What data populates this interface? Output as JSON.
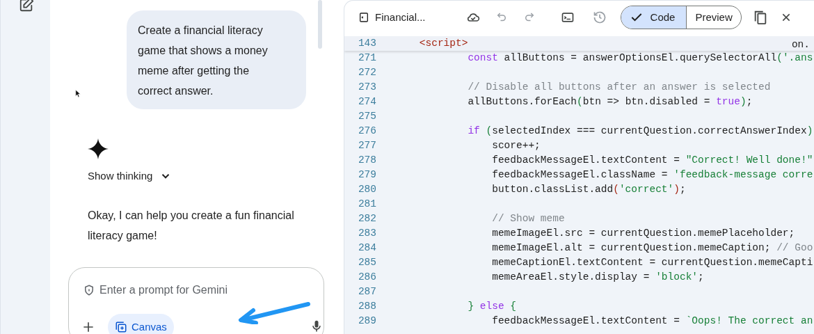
{
  "chat": {
    "user_message": "Create a financial literacy game that shows a money meme after getting the correct answer.",
    "thinking_toggle": {
      "label": "Show thinking",
      "expanded": false
    },
    "reply": "Okay, I can help you create a fun financial literacy game!",
    "prompt": {
      "placeholder": "Enter a prompt for Gemini",
      "tools": [
        {
          "label": "Canvas",
          "selected": true
        }
      ]
    }
  },
  "editor": {
    "file_title": "Financial...",
    "view_toggle": [
      {
        "label": "Code",
        "selected": true
      },
      {
        "label": "Preview",
        "selected": false
      }
    ],
    "sticky_line": {
      "number": "143",
      "kind": "script",
      "tokens": [
        {
          "kind": "tag",
          "text": "<script>"
        }
      ],
      "tail": "on."
    },
    "lines": [
      {
        "number": "271",
        "kind": "function",
        "tokens": [
          {
            "kind": "keyword",
            "text": "const"
          },
          {
            "kind": "plain",
            "text": " allButtons = answerOptionsEl.querySelectorAll"
          },
          {
            "kind": "bracket",
            "text": "("
          },
          {
            "kind": "string",
            "text": "'.ans"
          }
        ]
      },
      {
        "number": "272"
      },
      {
        "number": "273",
        "kind": "function",
        "tokens": [
          {
            "kind": "comment",
            "text": "// Disable all buttons after an answer is selected"
          }
        ]
      },
      {
        "number": "274",
        "kind": "function",
        "tokens": [
          {
            "kind": "plain",
            "text": "allButtons.forEach"
          },
          {
            "kind": "bracket",
            "text": "("
          },
          {
            "kind": "plain",
            "text": "btn => btn.disabled = "
          },
          {
            "kind": "keyword",
            "text": "true"
          },
          {
            "kind": "bracket",
            "text": ")"
          },
          {
            "kind": "plain",
            "text": ";"
          }
        ]
      },
      {
        "number": "275"
      },
      {
        "number": "276",
        "kind": "function",
        "tokens": [
          {
            "kind": "keyword",
            "text": "if"
          },
          {
            "kind": "bracket",
            "text": " ("
          },
          {
            "kind": "plain",
            "text": "selectedIndex === currentQuestion.correctAnswerIndex"
          },
          {
            "kind": "bracket",
            "text": ")"
          }
        ]
      },
      {
        "number": "277",
        "kind": "branch",
        "tokens": [
          {
            "kind": "plain",
            "text": "score++;"
          }
        ]
      },
      {
        "number": "278",
        "kind": "branch",
        "tokens": [
          {
            "kind": "plain",
            "text": "feedbackMessageEl.textContent = "
          },
          {
            "kind": "string",
            "text": "\"Correct! Well done!\""
          }
        ]
      },
      {
        "number": "279",
        "kind": "branch",
        "tokens": [
          {
            "kind": "plain",
            "text": "feedbackMessageEl.className = "
          },
          {
            "kind": "string",
            "text": "'feedback-message corre"
          }
        ]
      },
      {
        "number": "280",
        "kind": "branch",
        "tokens": [
          {
            "kind": "plain",
            "text": "button.classList.add"
          },
          {
            "kind": "bracket2",
            "text": "("
          },
          {
            "kind": "string",
            "text": "'correct'"
          },
          {
            "kind": "bracket2",
            "text": ")"
          },
          {
            "kind": "plain",
            "text": ";"
          }
        ]
      },
      {
        "number": "281"
      },
      {
        "number": "282",
        "kind": "branch",
        "tokens": [
          {
            "kind": "comment",
            "text": "// Show meme"
          }
        ]
      },
      {
        "number": "283",
        "kind": "branch",
        "tokens": [
          {
            "kind": "plain",
            "text": "memeImageEl.src = currentQuestion.memePlaceholder;"
          }
        ]
      },
      {
        "number": "284",
        "kind": "branch",
        "tokens": [
          {
            "kind": "plain",
            "text": "memeImageEl.alt = currentQuestion.memeCaption; "
          },
          {
            "kind": "comment",
            "text": "// Goo"
          }
        ]
      },
      {
        "number": "285",
        "kind": "branch",
        "tokens": [
          {
            "kind": "plain",
            "text": "memeCaptionEl.textContent = currentQuestion.memeCapti"
          }
        ]
      },
      {
        "number": "286",
        "kind": "branch",
        "tokens": [
          {
            "kind": "plain",
            "text": "memeAreaEl.style.display = "
          },
          {
            "kind": "string",
            "text": "'block'"
          },
          {
            "kind": "plain",
            "text": ";"
          }
        ]
      },
      {
        "number": "287"
      },
      {
        "number": "288",
        "kind": "function",
        "tokens": [
          {
            "kind": "bracket",
            "text": "}"
          },
          {
            "kind": "keyword",
            "text": " else"
          },
          {
            "kind": "bracket",
            "text": " {"
          }
        ]
      },
      {
        "number": "289",
        "kind": "branch",
        "tokens": [
          {
            "kind": "plain",
            "text": "feedbackMessageEl.textContent = "
          },
          {
            "kind": "string",
            "text": "`Oops! The correct an"
          }
        ]
      }
    ]
  }
}
